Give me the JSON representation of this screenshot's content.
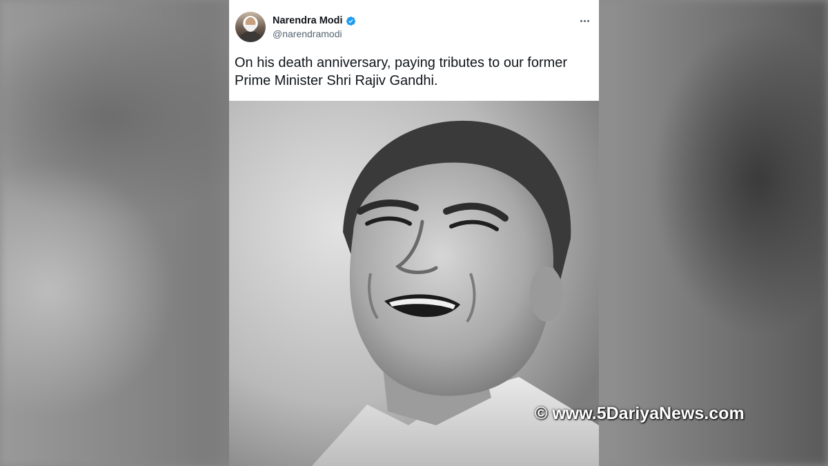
{
  "tweet": {
    "author_name": "Narendra Modi",
    "author_handle": "@narendramodi",
    "text": "On his death anniversary, paying tributes to our former Prime Minister Shri Rajiv Gandhi.",
    "photo_alt": "Black and white portrait of a smiling man",
    "icons": {
      "verified": "verified-badge-icon",
      "more": "more-options-icon"
    },
    "colors": {
      "verified": "#1d9bf0",
      "text": "#0f1419",
      "secondary": "#536471"
    }
  },
  "watermark": "© www.5DariyaNews.com"
}
